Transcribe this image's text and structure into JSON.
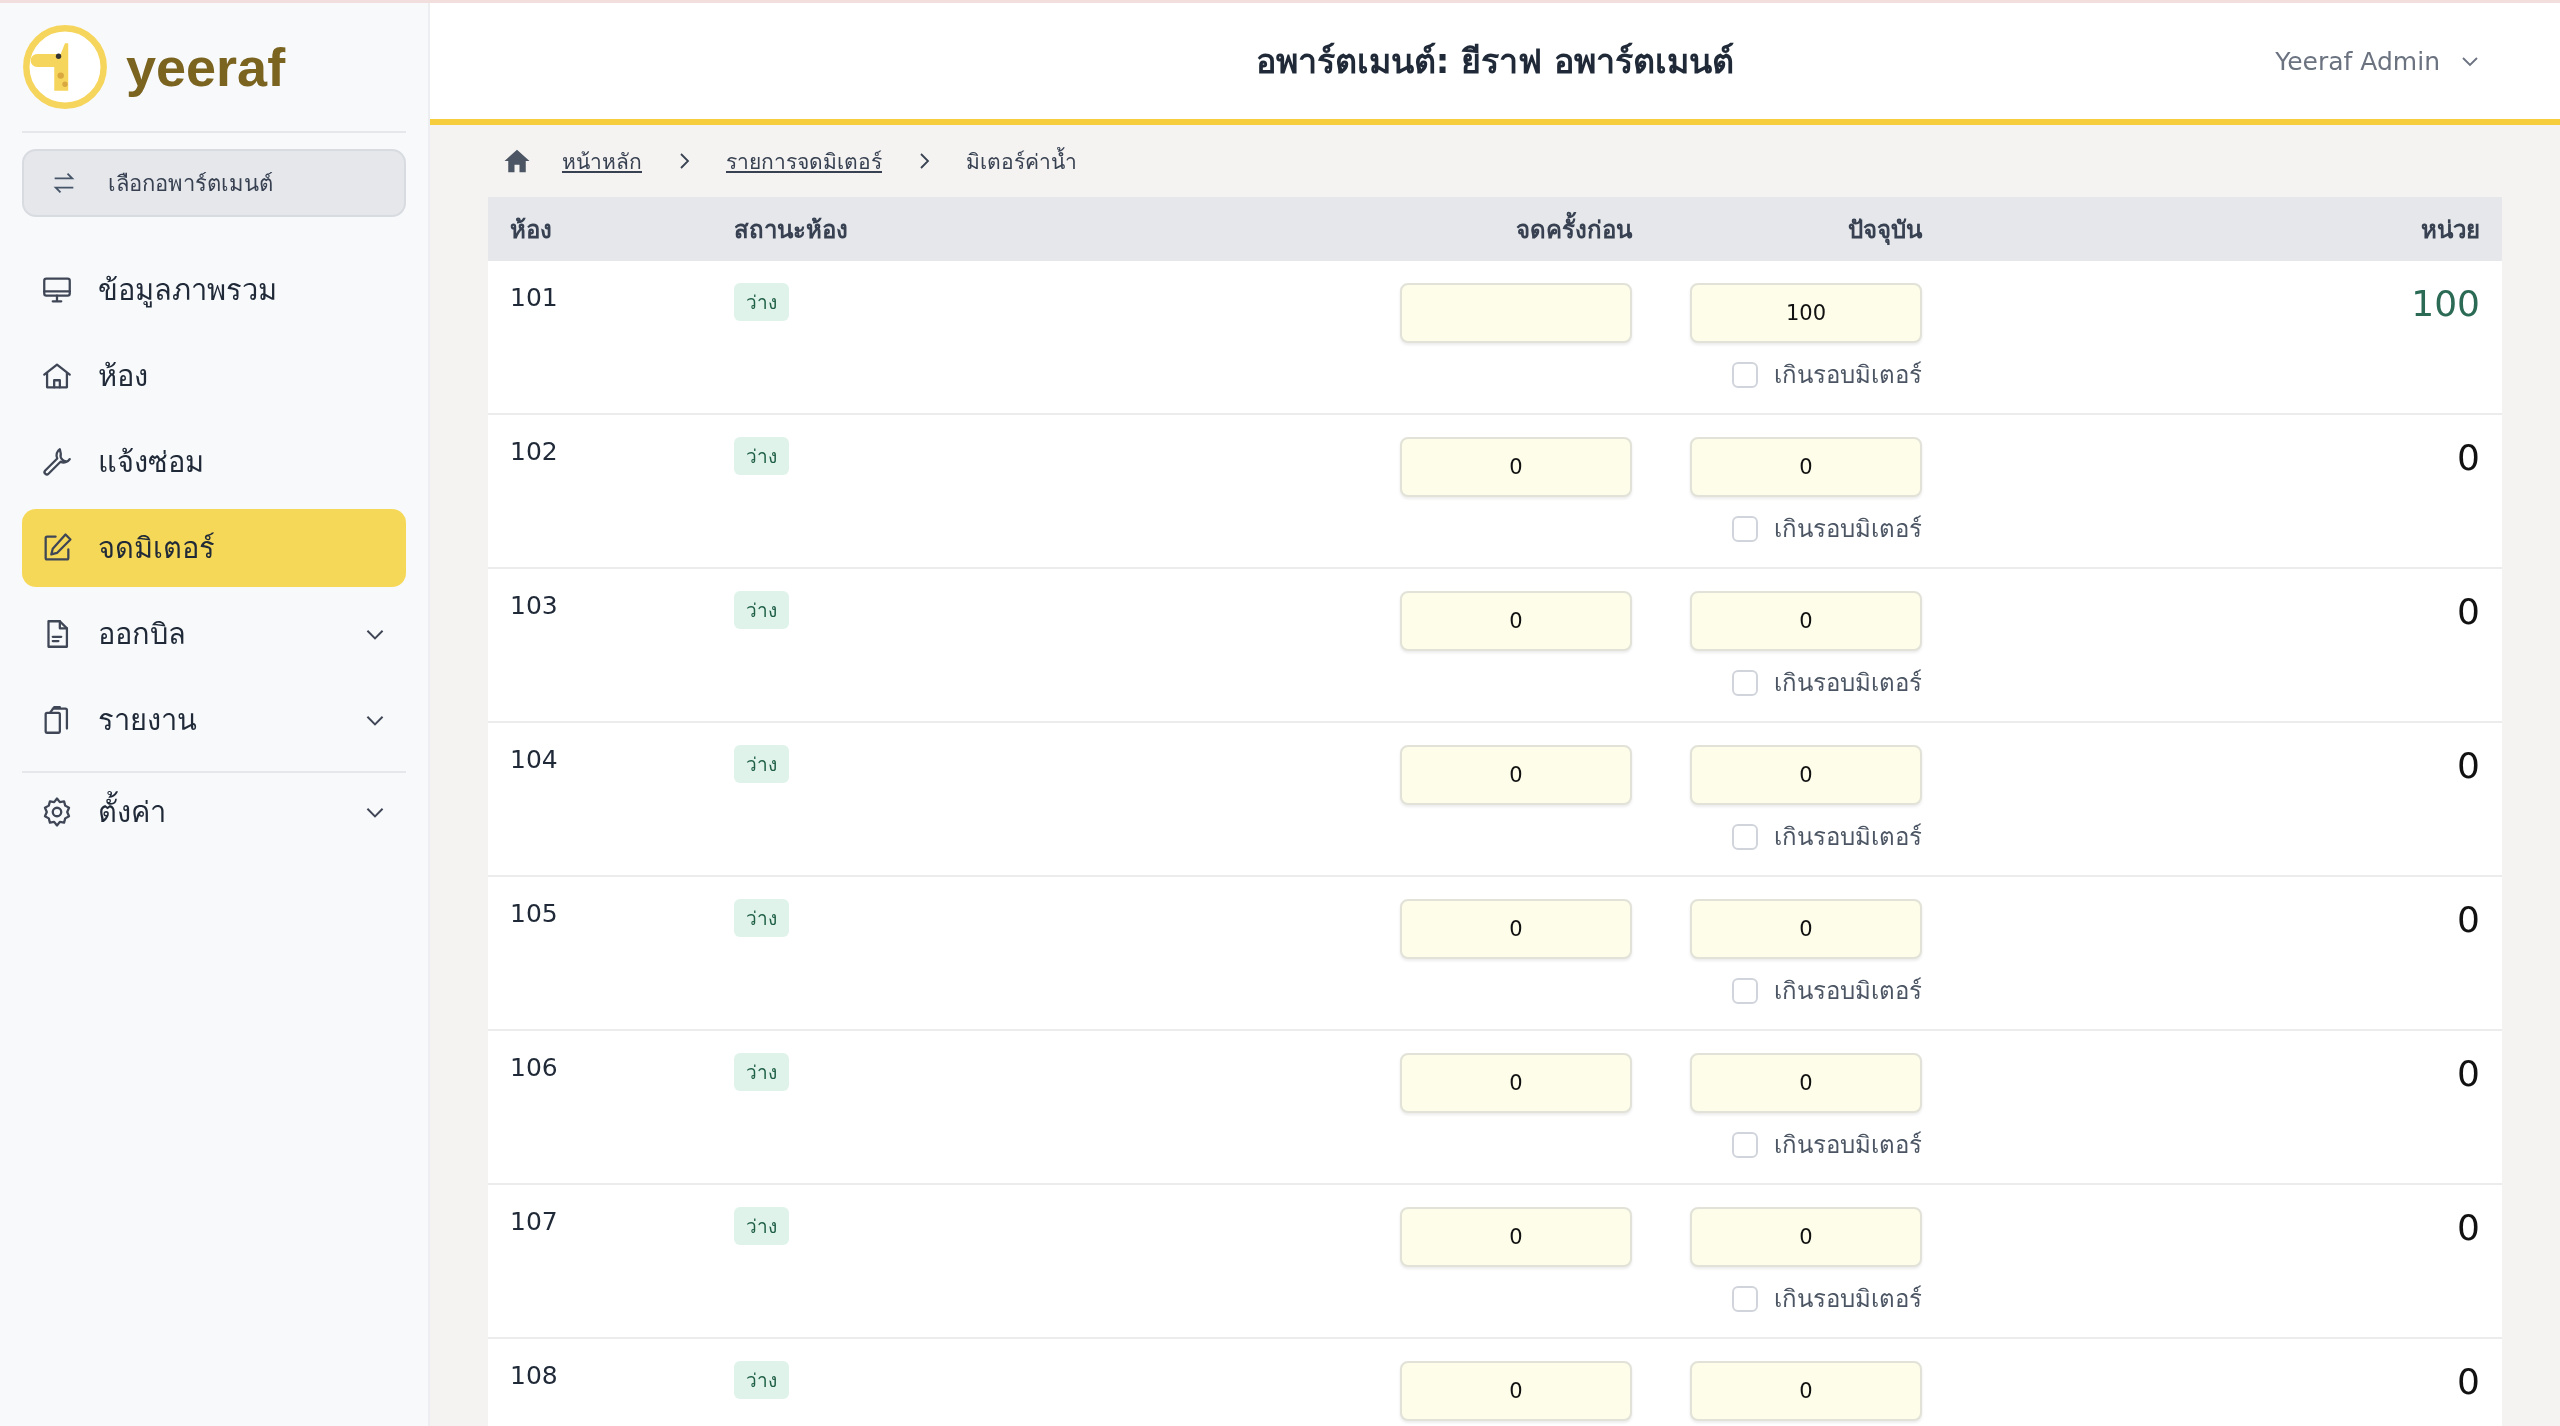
{
  "brand": {
    "name": "yeeraf"
  },
  "apartment_switch": {
    "label": "เลือกอพาร์ตเมนต์"
  },
  "sidebar": {
    "items": [
      {
        "label": "ข้อมูลภาพรวม",
        "selected": false
      },
      {
        "label": "ห้อง",
        "selected": false
      },
      {
        "label": "แจ้งซ่อม",
        "selected": false
      },
      {
        "label": "จดมิเตอร์",
        "selected": true
      },
      {
        "label": "ออกบิล",
        "selected": false,
        "expandable": true
      },
      {
        "label": "รายงาน",
        "selected": false,
        "expandable": true
      },
      {
        "label": "ตั้งค่า",
        "selected": false,
        "expandable": true,
        "divider_before": true
      }
    ]
  },
  "header": {
    "title": "อพาร์ตเมนต์: ยีราฟ อพาร์ตเมนต์",
    "user": "Yeeraf Admin"
  },
  "breadcrumb": [
    {
      "label": "หน้าหลัก",
      "link": true
    },
    {
      "label": "รายการจดมิเตอร์",
      "link": true
    },
    {
      "label": "มิเตอร์ค่าน้ำ",
      "link": false
    }
  ],
  "table": {
    "columns": [
      "ห้อง",
      "สถานะห้อง",
      "จดครั้งก่อน",
      "ปัจจุบัน",
      "หน่วย"
    ],
    "rows": [
      {
        "room": "101",
        "status": "ว่าง",
        "previous": "",
        "current": "100",
        "units": "100",
        "highlighted": true,
        "rollover": {
          "label": "เกินรอบมิเตอร์",
          "checked": false
        }
      },
      {
        "room": "102",
        "status": "ว่าง",
        "previous": "0",
        "current": "0",
        "units": "0",
        "highlighted": false,
        "rollover": {
          "label": "เกินรอบมิเตอร์",
          "checked": false
        }
      },
      {
        "room": "103",
        "status": "ว่าง",
        "previous": "0",
        "current": "0",
        "units": "0",
        "highlighted": false,
        "rollover": {
          "label": "เกินรอบมิเตอร์",
          "checked": false
        }
      },
      {
        "room": "104",
        "status": "ว่าง",
        "previous": "0",
        "current": "0",
        "units": "0",
        "highlighted": false,
        "rollover": {
          "label": "เกินรอบมิเตอร์",
          "checked": false
        }
      },
      {
        "room": "105",
        "status": "ว่าง",
        "previous": "0",
        "current": "0",
        "units": "0",
        "highlighted": false,
        "rollover": {
          "label": "เกินรอบมิเตอร์",
          "checked": false
        }
      },
      {
        "room": "106",
        "status": "ว่าง",
        "previous": "0",
        "current": "0",
        "units": "0",
        "highlighted": false,
        "rollover": {
          "label": "เกินรอบมิเตอร์",
          "checked": false
        }
      },
      {
        "room": "107",
        "status": "ว่าง",
        "previous": "0",
        "current": "0",
        "units": "0",
        "highlighted": false,
        "rollover": {
          "label": "เกินรอบมิเตอร์",
          "checked": false
        }
      },
      {
        "room": "108",
        "status": "ว่าง",
        "previous": "0",
        "current": "0",
        "units": "0",
        "highlighted": false
      }
    ]
  }
}
